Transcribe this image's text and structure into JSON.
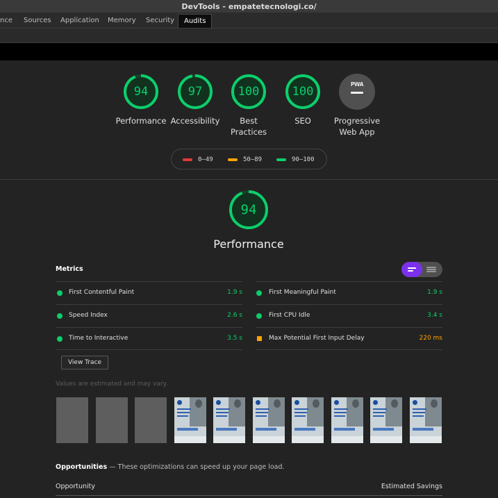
{
  "window": {
    "title": "DevTools - empatetecnologi.co/"
  },
  "tabs": [
    {
      "label": "nce"
    },
    {
      "label": "Sources"
    },
    {
      "label": "Application"
    },
    {
      "label": "Memory"
    },
    {
      "label": "Security"
    },
    {
      "label": "Audits",
      "active": true
    }
  ],
  "categories": [
    {
      "label": "Performance",
      "score": "94",
      "value": 94
    },
    {
      "label": "Accessibility",
      "score": "97",
      "value": 97
    },
    {
      "label": "Best Practices",
      "score": "100",
      "value": 100
    },
    {
      "label": "SEO",
      "score": "100",
      "value": 100
    },
    {
      "label": "Progressive Web App",
      "badge": "PWA"
    }
  ],
  "legend": [
    {
      "range": "0–49",
      "color": "#e03a3a"
    },
    {
      "range": "50–89",
      "color": "#ffa400"
    },
    {
      "range": "90–100",
      "color": "#0cce6b"
    }
  ],
  "performance": {
    "score": "94",
    "value": 94,
    "title": "Performance"
  },
  "metrics": {
    "heading": "Metrics",
    "left": [
      {
        "label": "First Contentful Paint",
        "value": "1.9 s",
        "status": "pass"
      },
      {
        "label": "Speed Index",
        "value": "2.6 s",
        "status": "pass"
      },
      {
        "label": "Time to Interactive",
        "value": "3.5 s",
        "status": "pass"
      }
    ],
    "right": [
      {
        "label": "First Meaningful Paint",
        "value": "1.9 s",
        "status": "pass"
      },
      {
        "label": "First CPU Idle",
        "value": "3.4 s",
        "status": "pass"
      },
      {
        "label": "Max Potential First Input Delay",
        "value": "220 ms",
        "status": "average"
      }
    ]
  },
  "view_trace_label": "View Trace",
  "estimate_note": "Values are estimated and may vary.",
  "filmstrip": [
    "blank",
    "blank",
    "blank",
    "page",
    "page",
    "page",
    "page",
    "page",
    "page",
    "page"
  ],
  "opportunities": {
    "title": "Opportunities",
    "description": "— These optimizations can speed up your page load.",
    "col_opportunity": "Opportunity",
    "col_savings": "Estimated Savings"
  },
  "colors": {
    "pass": "#0cce6b",
    "average": "#ffa400",
    "fail": "#e03a3a",
    "accent": "#7b30ec"
  }
}
